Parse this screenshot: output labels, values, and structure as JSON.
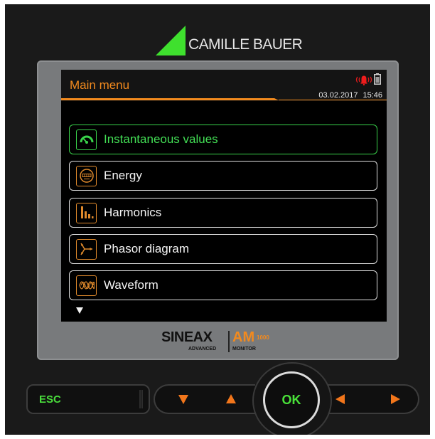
{
  "brand": {
    "name": "CAMILLE BAUER",
    "logo_color": "#3fe02e"
  },
  "screen": {
    "title": "Main menu",
    "date": "03.02.2017",
    "time": "15:46",
    "status_icons": [
      "alarm-bell-icon",
      "battery-icon"
    ],
    "accent_color": "#f28a1e",
    "highlight_color": "#39d24a"
  },
  "menu": {
    "items": [
      {
        "label": "Instantaneous values",
        "icon": "gauge-icon",
        "selected": true
      },
      {
        "label": "Energy",
        "icon": "energy-meter-icon",
        "selected": false
      },
      {
        "label": "Harmonics",
        "icon": "harmonics-bars-icon",
        "selected": false
      },
      {
        "label": "Phasor diagram",
        "icon": "phasor-diagram-icon",
        "selected": false
      },
      {
        "label": "Waveform",
        "icon": "waveform-icon",
        "selected": false
      }
    ],
    "more_indicator": "scroll-down-icon"
  },
  "product": {
    "brand": "SINEAX",
    "line": "ADVANCED",
    "model": "AM",
    "model_suffix": "1000",
    "type": "MONITOR"
  },
  "keypad": {
    "esc_label": "ESC",
    "ok_label": "OK",
    "keys": [
      "down-arrow-icon",
      "up-arrow-icon",
      "left-arrow-icon",
      "right-arrow-icon"
    ]
  }
}
